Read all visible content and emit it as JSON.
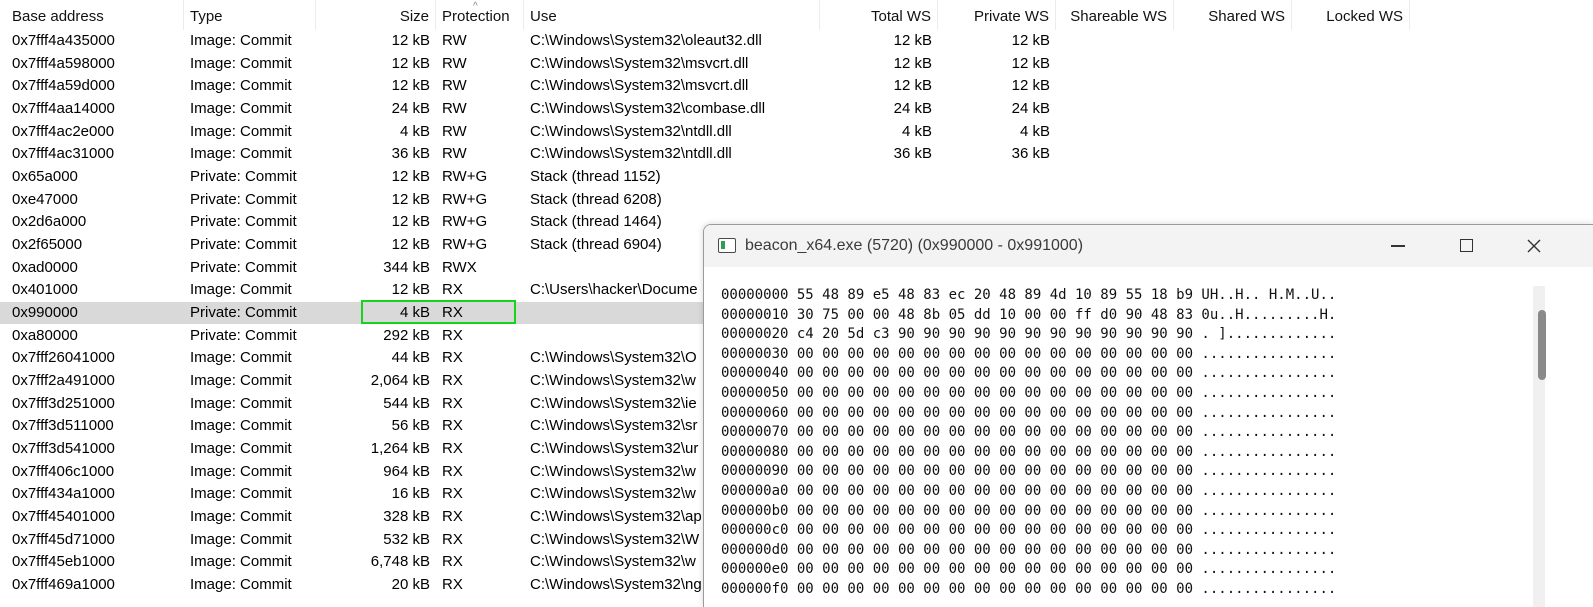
{
  "columns": {
    "base": "Base address",
    "type": "Type",
    "size": "Size",
    "protection": "Protection",
    "use": "Use",
    "total_ws": "Total WS",
    "private_ws": "Private WS",
    "shareable_ws": "Shareable WS",
    "shared_ws": "Shared WS",
    "locked_ws": "Locked WS"
  },
  "rows": [
    {
      "base": "0x7fff4a435000",
      "type": "Image: Commit",
      "size": "12 kB",
      "prot": "RW",
      "use": "C:\\Windows\\System32\\oleaut32.dll",
      "tws": "12 kB",
      "pws": "12 kB"
    },
    {
      "base": "0x7fff4a598000",
      "type": "Image: Commit",
      "size": "12 kB",
      "prot": "RW",
      "use": "C:\\Windows\\System32\\msvcrt.dll",
      "tws": "12 kB",
      "pws": "12 kB"
    },
    {
      "base": "0x7fff4a59d000",
      "type": "Image: Commit",
      "size": "12 kB",
      "prot": "RW",
      "use": "C:\\Windows\\System32\\msvcrt.dll",
      "tws": "12 kB",
      "pws": "12 kB"
    },
    {
      "base": "0x7fff4aa14000",
      "type": "Image: Commit",
      "size": "24 kB",
      "prot": "RW",
      "use": "C:\\Windows\\System32\\combase.dll",
      "tws": "24 kB",
      "pws": "24 kB"
    },
    {
      "base": "0x7fff4ac2e000",
      "type": "Image: Commit",
      "size": "4 kB",
      "prot": "RW",
      "use": "C:\\Windows\\System32\\ntdll.dll",
      "tws": "4 kB",
      "pws": "4 kB"
    },
    {
      "base": "0x7fff4ac31000",
      "type": "Image: Commit",
      "size": "36 kB",
      "prot": "RW",
      "use": "C:\\Windows\\System32\\ntdll.dll",
      "tws": "36 kB",
      "pws": "36 kB"
    },
    {
      "base": "0x65a000",
      "type": "Private: Commit",
      "size": "12 kB",
      "prot": "RW+G",
      "use": "Stack (thread 1152)",
      "tws": "",
      "pws": ""
    },
    {
      "base": "0xe47000",
      "type": "Private: Commit",
      "size": "12 kB",
      "prot": "RW+G",
      "use": "Stack (thread 6208)",
      "tws": "",
      "pws": ""
    },
    {
      "base": "0x2d6a000",
      "type": "Private: Commit",
      "size": "12 kB",
      "prot": "RW+G",
      "use": "Stack (thread 1464)",
      "tws": "",
      "pws": ""
    },
    {
      "base": "0x2f65000",
      "type": "Private: Commit",
      "size": "12 kB",
      "prot": "RW+G",
      "use": "Stack (thread 6904)",
      "tws": "",
      "pws": ""
    },
    {
      "base": "0xad0000",
      "type": "Private: Commit",
      "size": "344 kB",
      "prot": "RWX",
      "use": "",
      "tws": "",
      "pws": ""
    },
    {
      "base": "0x401000",
      "type": "Image: Commit",
      "size": "12 kB",
      "prot": "RX",
      "use": "C:\\Users\\hacker\\Docume",
      "tws": "",
      "pws": ""
    },
    {
      "base": "0x990000",
      "type": "Private: Commit",
      "size": "4 kB",
      "prot": "RX",
      "use": "",
      "tws": "",
      "pws": ""
    },
    {
      "base": "0xa80000",
      "type": "Private: Commit",
      "size": "292 kB",
      "prot": "RX",
      "use": "",
      "tws": "",
      "pws": ""
    },
    {
      "base": "0x7fff26041000",
      "type": "Image: Commit",
      "size": "44 kB",
      "prot": "RX",
      "use": "C:\\Windows\\System32\\O",
      "tws": "",
      "pws": ""
    },
    {
      "base": "0x7fff2a491000",
      "type": "Image: Commit",
      "size": "2,064 kB",
      "prot": "RX",
      "use": "C:\\Windows\\System32\\w",
      "tws": "",
      "pws": ""
    },
    {
      "base": "0x7fff3d251000",
      "type": "Image: Commit",
      "size": "544 kB",
      "prot": "RX",
      "use": "C:\\Windows\\System32\\ie",
      "tws": "",
      "pws": ""
    },
    {
      "base": "0x7fff3d511000",
      "type": "Image: Commit",
      "size": "56 kB",
      "prot": "RX",
      "use": "C:\\Windows\\System32\\sr",
      "tws": "",
      "pws": ""
    },
    {
      "base": "0x7fff3d541000",
      "type": "Image: Commit",
      "size": "1,264 kB",
      "prot": "RX",
      "use": "C:\\Windows\\System32\\ur",
      "tws": "",
      "pws": ""
    },
    {
      "base": "0x7fff406c1000",
      "type": "Image: Commit",
      "size": "964 kB",
      "prot": "RX",
      "use": "C:\\Windows\\System32\\w",
      "tws": "",
      "pws": ""
    },
    {
      "base": "0x7fff434a1000",
      "type": "Image: Commit",
      "size": "16 kB",
      "prot": "RX",
      "use": "C:\\Windows\\System32\\w",
      "tws": "",
      "pws": ""
    },
    {
      "base": "0x7fff45401000",
      "type": "Image: Commit",
      "size": "328 kB",
      "prot": "RX",
      "use": "C:\\Windows\\System32\\ap",
      "tws": "",
      "pws": ""
    },
    {
      "base": "0x7fff45d71000",
      "type": "Image: Commit",
      "size": "532 kB",
      "prot": "RX",
      "use": "C:\\Windows\\System32\\W",
      "tws": "",
      "pws": ""
    },
    {
      "base": "0x7fff45eb1000",
      "type": "Image: Commit",
      "size": "6,748 kB",
      "prot": "RX",
      "use": "C:\\Windows\\System32\\w",
      "tws": "",
      "pws": ""
    },
    {
      "base": "0x7fff469a1000",
      "type": "Image: Commit",
      "size": "20 kB",
      "prot": "RX",
      "use": "C:\\Windows\\System32\\ng",
      "tws": "",
      "pws": ""
    }
  ],
  "selected_row_base": "0x990000",
  "highlight_color": "#19d21f",
  "hex_window": {
    "title": "beacon_x64.exe (5720) (0x990000 - 0x991000)",
    "controls": {
      "minimize": "minimize-icon",
      "maximize": "maximize-icon",
      "close": "close-icon"
    },
    "lines": [
      "00000000 55 48 89 e5 48 83 ec 20 48 89 4d 10 89 55 18 b9 UH..H.. H.M..U..",
      "00000010 30 75 00 00 48 8b 05 dd 10 00 00 ff d0 90 48 83 0u..H.........H.",
      "00000020 c4 20 5d c3 90 90 90 90 90 90 90 90 90 90 90 90 . ].............",
      "00000030 00 00 00 00 00 00 00 00 00 00 00 00 00 00 00 00 ................",
      "00000040 00 00 00 00 00 00 00 00 00 00 00 00 00 00 00 00 ................",
      "00000050 00 00 00 00 00 00 00 00 00 00 00 00 00 00 00 00 ................",
      "00000060 00 00 00 00 00 00 00 00 00 00 00 00 00 00 00 00 ................",
      "00000070 00 00 00 00 00 00 00 00 00 00 00 00 00 00 00 00 ................",
      "00000080 00 00 00 00 00 00 00 00 00 00 00 00 00 00 00 00 ................",
      "00000090 00 00 00 00 00 00 00 00 00 00 00 00 00 00 00 00 ................",
      "000000a0 00 00 00 00 00 00 00 00 00 00 00 00 00 00 00 00 ................",
      "000000b0 00 00 00 00 00 00 00 00 00 00 00 00 00 00 00 00 ................",
      "000000c0 00 00 00 00 00 00 00 00 00 00 00 00 00 00 00 00 ................",
      "000000d0 00 00 00 00 00 00 00 00 00 00 00 00 00 00 00 00 ................",
      "000000e0 00 00 00 00 00 00 00 00 00 00 00 00 00 00 00 00 ................",
      "000000f0 00 00 00 00 00 00 00 00 00 00 00 00 00 00 00 00 ................"
    ]
  }
}
